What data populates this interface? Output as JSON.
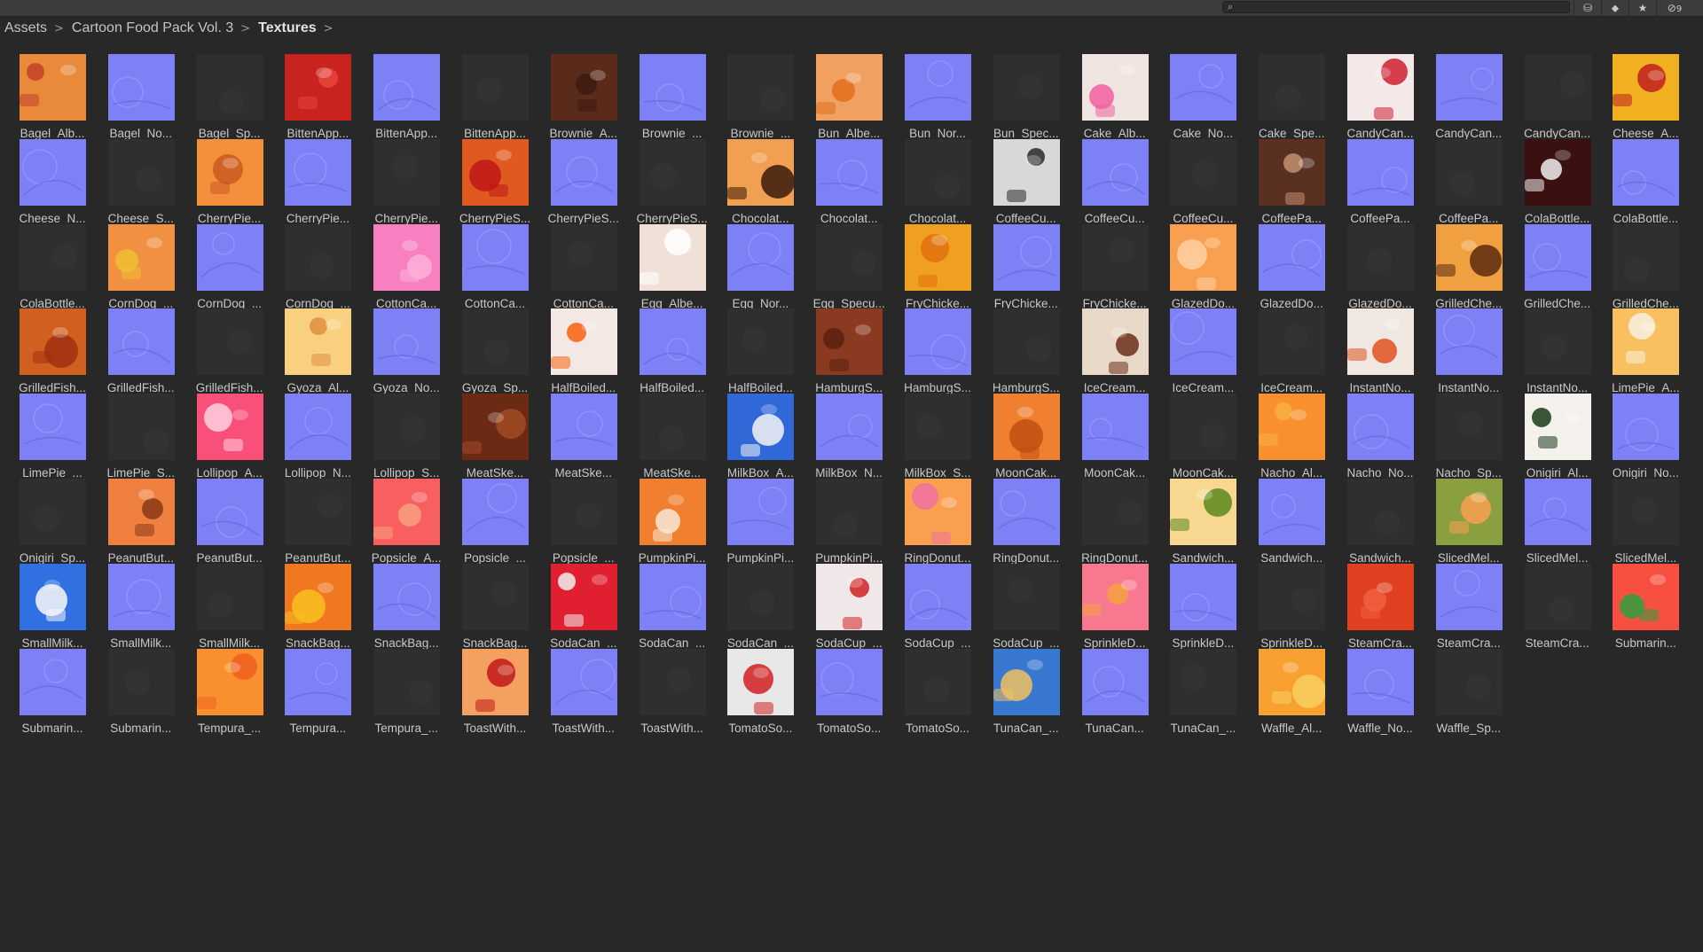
{
  "toolbar": {
    "search_value": "",
    "search_icon": "magnifier-icon",
    "buttons": [
      {
        "icon": "filter-by-type-icon",
        "glyph": "⛁"
      },
      {
        "icon": "filter-by-label-icon",
        "glyph": "⬥"
      },
      {
        "icon": "favorite-star-icon",
        "glyph": "★"
      },
      {
        "icon": "hidden-packages-icon",
        "glyph": "⊘",
        "count": "9"
      }
    ]
  },
  "breadcrumb": [
    {
      "label": "Assets",
      "active": false
    },
    {
      "label": "Cartoon Food Pack Vol. 3",
      "active": false
    },
    {
      "label": "Textures",
      "active": true
    }
  ],
  "colors": {
    "normal_map": "#7e80f6",
    "specular": "#2f2f2f",
    "background": "#282828"
  },
  "assets": [
    {
      "label": "Bagel_Alb...",
      "type": "albedo",
      "base": "#e88a3a",
      "accent": "#c3402a"
    },
    {
      "label": "Bagel_No...",
      "type": "normal"
    },
    {
      "label": "Bagel_Sp...",
      "type": "spec"
    },
    {
      "label": "BittenApp...",
      "type": "albedo",
      "base": "#c8231f",
      "accent": "#e8463c"
    },
    {
      "label": "BittenApp...",
      "type": "normal"
    },
    {
      "label": "BittenApp...",
      "type": "spec"
    },
    {
      "label": "Brownie_A...",
      "type": "albedo",
      "base": "#5a2a1a",
      "accent": "#3e1a10"
    },
    {
      "label": "Brownie_...",
      "type": "normal"
    },
    {
      "label": "Brownie_...",
      "type": "spec"
    },
    {
      "label": "Bun_Albe...",
      "type": "albedo",
      "base": "#f0a060",
      "accent": "#e0701c"
    },
    {
      "label": "Bun_Nor...",
      "type": "normal"
    },
    {
      "label": "Bun_Spec...",
      "type": "spec"
    },
    {
      "label": "Cake_Alb...",
      "type": "albedo",
      "base": "#f0e4e0",
      "accent": "#f060a0"
    },
    {
      "label": "Cake_No...",
      "type": "normal"
    },
    {
      "label": "Cake_Spe...",
      "type": "spec"
    },
    {
      "label": "CandyCan...",
      "type": "albedo",
      "base": "#f4e8e8",
      "accent": "#d02030"
    },
    {
      "label": "CandyCan...",
      "type": "normal"
    },
    {
      "label": "CandyCan...",
      "type": "spec"
    },
    {
      "label": "Cheese_A...",
      "type": "albedo",
      "base": "#f0b020",
      "accent": "#c02020"
    },
    {
      "label": "Cheese_N...",
      "type": "normal"
    },
    {
      "label": "Cheese_S...",
      "type": "spec"
    },
    {
      "label": "CherryPie...",
      "type": "albedo",
      "base": "#f4903c",
      "accent": "#c85a20"
    },
    {
      "label": "CherryPie...",
      "type": "normal"
    },
    {
      "label": "CherryPie...",
      "type": "spec"
    },
    {
      "label": "CherryPieS...",
      "type": "albedo",
      "base": "#e05a20",
      "accent": "#c01818"
    },
    {
      "label": "CherryPieS...",
      "type": "normal"
    },
    {
      "label": "CherryPieS...",
      "type": "spec"
    },
    {
      "label": "Chocolat...",
      "type": "albedo",
      "base": "#f0a050",
      "accent": "#3a1a0a"
    },
    {
      "label": "Chocolat...",
      "type": "normal"
    },
    {
      "label": "Chocolat...",
      "type": "spec"
    },
    {
      "label": "CoffeeCu...",
      "type": "albedo",
      "base": "#d8d8d8",
      "accent": "#2a2a2a"
    },
    {
      "label": "CoffeeCu...",
      "type": "normal"
    },
    {
      "label": "CoffeeCu...",
      "type": "spec"
    },
    {
      "label": "CoffeePa...",
      "type": "albedo",
      "base": "#5a3020",
      "accent": "#c09070"
    },
    {
      "label": "CoffeePa...",
      "type": "normal"
    },
    {
      "label": "CoffeePa...",
      "type": "spec"
    },
    {
      "label": "ColaBottle...",
      "type": "albedo",
      "base": "#3a1010",
      "accent": "#f0f0f0"
    },
    {
      "label": "ColaBottle...",
      "type": "normal"
    },
    {
      "label": "ColaBottle...",
      "type": "spec"
    },
    {
      "label": "CornDog_...",
      "type": "albedo",
      "base": "#f09040",
      "accent": "#f0c030"
    },
    {
      "label": "CornDog_...",
      "type": "normal"
    },
    {
      "label": "CornDog_...",
      "type": "spec"
    },
    {
      "label": "CottonCa...",
      "type": "albedo",
      "base": "#f880c0",
      "accent": "#ffb0d8"
    },
    {
      "label": "CottonCa...",
      "type": "normal"
    },
    {
      "label": "CottonCa...",
      "type": "spec"
    },
    {
      "label": "Egg_Albe...",
      "type": "albedo",
      "base": "#f0e0d8",
      "accent": "#ffffff"
    },
    {
      "label": "Egg_Nor...",
      "type": "normal"
    },
    {
      "label": "Egg_Specu...",
      "type": "spec"
    },
    {
      "label": "FryChicke...",
      "type": "albedo",
      "base": "#f0a020",
      "accent": "#e07010"
    },
    {
      "label": "FryChicke...",
      "type": "normal"
    },
    {
      "label": "FryChicke...",
      "type": "spec"
    },
    {
      "label": "GlazedDo...",
      "type": "albedo",
      "base": "#f8a050",
      "accent": "#ffd0a0"
    },
    {
      "label": "GlazedDo...",
      "type": "normal"
    },
    {
      "label": "GlazedDo...",
      "type": "spec"
    },
    {
      "label": "GrilledChe...",
      "type": "albedo",
      "base": "#f0a040",
      "accent": "#5a2a10"
    },
    {
      "label": "GrilledChe...",
      "type": "normal"
    },
    {
      "label": "GrilledChe...",
      "type": "spec"
    },
    {
      "label": "GrilledFish...",
      "type": "albedo",
      "base": "#d06020",
      "accent": "#a03010"
    },
    {
      "label": "GrilledFish...",
      "type": "normal"
    },
    {
      "label": "GrilledFish...",
      "type": "spec"
    },
    {
      "label": "Gyoza_Al...",
      "type": "albedo",
      "base": "#f8d080",
      "accent": "#e09040"
    },
    {
      "label": "Gyoza_No...",
      "type": "normal"
    },
    {
      "label": "Gyoza_Sp...",
      "type": "spec"
    },
    {
      "label": "HalfBoiled...",
      "type": "albedo",
      "base": "#f4e8e4",
      "accent": "#f86010"
    },
    {
      "label": "HalfBoiled...",
      "type": "normal"
    },
    {
      "label": "HalfBoiled...",
      "type": "spec"
    },
    {
      "label": "HamburgS...",
      "type": "albedo",
      "base": "#8a3a20",
      "accent": "#5a2010"
    },
    {
      "label": "HamburgS...",
      "type": "normal"
    },
    {
      "label": "HamburgS...",
      "type": "spec"
    },
    {
      "label": "IceCream...",
      "type": "albedo",
      "base": "#e8d8c8",
      "accent": "#6a3018"
    },
    {
      "label": "IceCream...",
      "type": "normal"
    },
    {
      "label": "IceCream...",
      "type": "spec"
    },
    {
      "label": "InstantNo...",
      "type": "albedo",
      "base": "#f0e8e0",
      "accent": "#e05020"
    },
    {
      "label": "InstantNo...",
      "type": "normal"
    },
    {
      "label": "InstantNo...",
      "type": "spec"
    },
    {
      "label": "LimePie_A...",
      "type": "albedo",
      "base": "#f8c060",
      "accent": "#f8f0e0"
    },
    {
      "label": "LimePie_...",
      "type": "normal"
    },
    {
      "label": "LimePie_S...",
      "type": "spec"
    },
    {
      "label": "Lollipop_A...",
      "type": "albedo",
      "base": "#f85078",
      "accent": "#ffd0e0"
    },
    {
      "label": "Lollipop_N...",
      "type": "normal"
    },
    {
      "label": "Lollipop_S...",
      "type": "spec"
    },
    {
      "label": "MeatSke...",
      "type": "albedo",
      "base": "#6a2a14",
      "accent": "#a04a24"
    },
    {
      "label": "MeatSke...",
      "type": "normal"
    },
    {
      "label": "MeatSke...",
      "type": "spec"
    },
    {
      "label": "MilkBox_A...",
      "type": "albedo",
      "base": "#3068d8",
      "accent": "#f4f4f4"
    },
    {
      "label": "MilkBox_N...",
      "type": "normal"
    },
    {
      "label": "MilkBox_S...",
      "type": "spec"
    },
    {
      "label": "MoonCak...",
      "type": "albedo",
      "base": "#f08030",
      "accent": "#c05010"
    },
    {
      "label": "MoonCak...",
      "type": "normal"
    },
    {
      "label": "MoonCak...",
      "type": "spec"
    },
    {
      "label": "Nacho_Al...",
      "type": "albedo",
      "base": "#f89030",
      "accent": "#f8b040"
    },
    {
      "label": "Nacho_No...",
      "type": "normal"
    },
    {
      "label": "Nacho_Sp...",
      "type": "spec"
    },
    {
      "label": "Onigiri_Al...",
      "type": "albedo",
      "base": "#f4f0ec",
      "accent": "#1a3a1a"
    },
    {
      "label": "Onigiri_No...",
      "type": "normal"
    },
    {
      "label": "Onigiri_Sp...",
      "type": "spec"
    },
    {
      "label": "PeanutBut...",
      "type": "albedo",
      "base": "#f08040",
      "accent": "#8a3818"
    },
    {
      "label": "PeanutBut...",
      "type": "normal"
    },
    {
      "label": "PeanutBut...",
      "type": "spec"
    },
    {
      "label": "Popsicle_A...",
      "type": "albedo",
      "base": "#f86060",
      "accent": "#f8a080"
    },
    {
      "label": "Popsicle_...",
      "type": "normal"
    },
    {
      "label": "Popsicle_...",
      "type": "spec"
    },
    {
      "label": "PumpkinPi...",
      "type": "albedo",
      "base": "#f08030",
      "accent": "#f8e8d8"
    },
    {
      "label": "PumpkinPi...",
      "type": "normal"
    },
    {
      "label": "PumpkinPi...",
      "type": "spec"
    },
    {
      "label": "RingDonut...",
      "type": "albedo",
      "base": "#f8a050",
      "accent": "#f070a0"
    },
    {
      "label": "RingDonut...",
      "type": "normal"
    },
    {
      "label": "RingDonut...",
      "type": "spec"
    },
    {
      "label": "Sandwich...",
      "type": "albedo",
      "base": "#f8d890",
      "accent": "#5a8a20"
    },
    {
      "label": "Sandwich...",
      "type": "normal"
    },
    {
      "label": "Sandwich...",
      "type": "spec"
    },
    {
      "label": "SlicedMel...",
      "type": "albedo",
      "base": "#8aa040",
      "accent": "#f8a050"
    },
    {
      "label": "SlicedMel...",
      "type": "normal"
    },
    {
      "label": "SlicedMel...",
      "type": "spec"
    },
    {
      "label": "SmallMilk...",
      "type": "albedo",
      "base": "#3070e0",
      "accent": "#f8f8f8"
    },
    {
      "label": "SmallMilk...",
      "type": "normal"
    },
    {
      "label": "SmallMilk...",
      "type": "spec"
    },
    {
      "label": "SnackBag...",
      "type": "albedo",
      "base": "#f07820",
      "accent": "#f8c020"
    },
    {
      "label": "SnackBag...",
      "type": "normal"
    },
    {
      "label": "SnackBag...",
      "type": "spec"
    },
    {
      "label": "SodaCan_...",
      "type": "albedo",
      "base": "#e02030",
      "accent": "#f0f0f0"
    },
    {
      "label": "SodaCan_...",
      "type": "normal"
    },
    {
      "label": "SodaCan_...",
      "type": "spec"
    },
    {
      "label": "SodaCup_...",
      "type": "albedo",
      "base": "#f0e8e8",
      "accent": "#d02020"
    },
    {
      "label": "SodaCup_...",
      "type": "normal"
    },
    {
      "label": "SodaCup_...",
      "type": "spec"
    },
    {
      "label": "SprinkleD...",
      "type": "albedo",
      "base": "#f87890",
      "accent": "#f8a040"
    },
    {
      "label": "SprinkleD...",
      "type": "normal"
    },
    {
      "label": "SprinkleD...",
      "type": "spec"
    },
    {
      "label": "SteamCra...",
      "type": "albedo",
      "base": "#e04020",
      "accent": "#f06040"
    },
    {
      "label": "SteamCra...",
      "type": "normal"
    },
    {
      "label": "SteamCra...",
      "type": "spec"
    },
    {
      "label": "Submarin...",
      "type": "albedo",
      "base": "#f85040",
      "accent": "#30a040"
    },
    {
      "label": "Submarin...",
      "type": "normal"
    },
    {
      "label": "Submarin...",
      "type": "spec"
    },
    {
      "label": "Tempura_...",
      "type": "albedo",
      "base": "#f89030",
      "accent": "#f06020"
    },
    {
      "label": "Tempura...",
      "type": "normal"
    },
    {
      "label": "Tempura_...",
      "type": "spec"
    },
    {
      "label": "ToastWith...",
      "type": "albedo",
      "base": "#f4a060",
      "accent": "#c01818"
    },
    {
      "label": "ToastWith...",
      "type": "normal"
    },
    {
      "label": "ToastWith...",
      "type": "spec"
    },
    {
      "label": "TomatoSo...",
      "type": "albedo",
      "base": "#e8e8e8",
      "accent": "#d02020"
    },
    {
      "label": "TomatoSo...",
      "type": "normal"
    },
    {
      "label": "TomatoSo...",
      "type": "spec"
    },
    {
      "label": "TunaCan_...",
      "type": "albedo",
      "base": "#3878d0",
      "accent": "#f0c060"
    },
    {
      "label": "TunaCan...",
      "type": "normal"
    },
    {
      "label": "TunaCan_...",
      "type": "spec"
    },
    {
      "label": "Waffle_Al...",
      "type": "albedo",
      "base": "#f8a030",
      "accent": "#f8d060"
    },
    {
      "label": "Waffle_No...",
      "type": "normal"
    },
    {
      "label": "Waffle_Sp...",
      "type": "spec"
    }
  ]
}
